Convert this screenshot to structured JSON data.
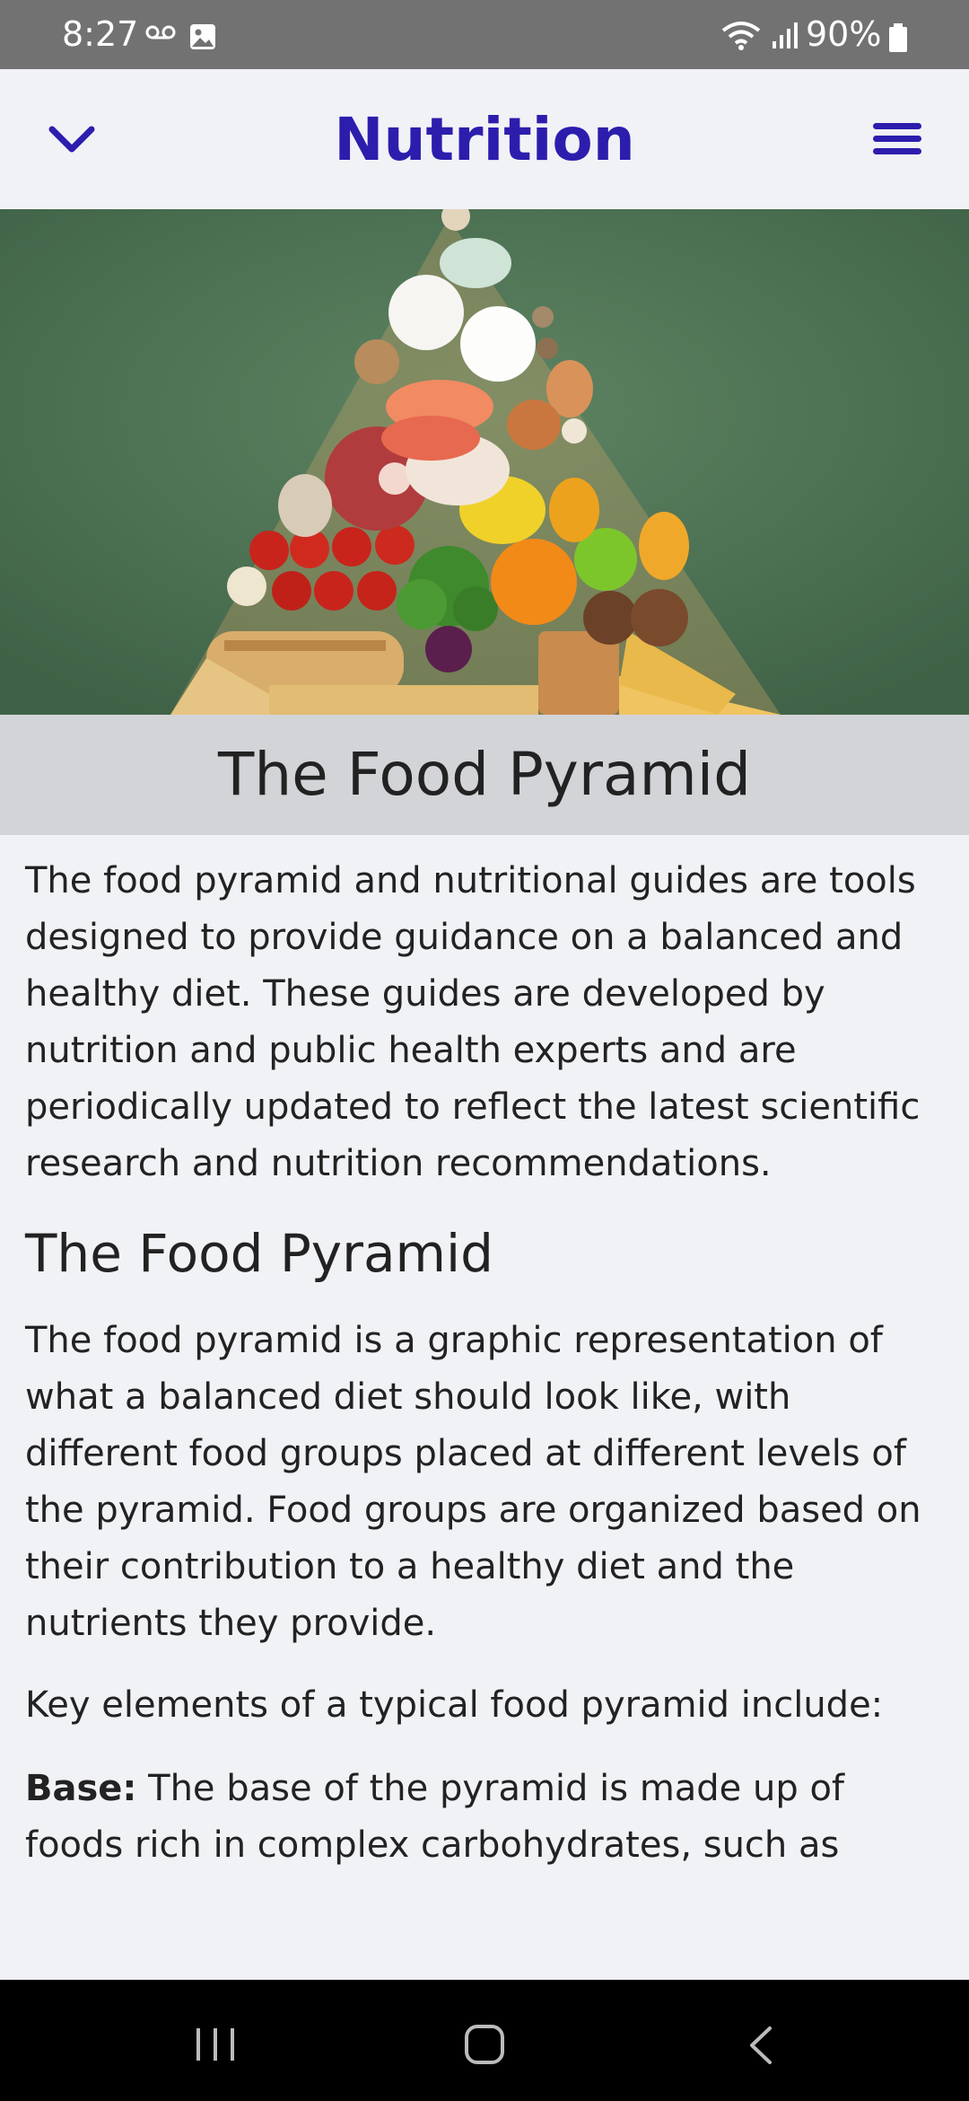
{
  "status_bar": {
    "time": "8:27",
    "battery": "90%"
  },
  "app_bar": {
    "title": "Nutrition",
    "collapse_icon": "chevron-down-icon",
    "menu_icon": "hamburger-menu-icon"
  },
  "hero_image": {
    "description_icon": "food-pyramid-photo"
  },
  "title_band": {
    "title": "The Food Pyramid"
  },
  "content": {
    "intro": "The food pyramid and nutritional guides are tools designed to provide guidance on a balanced and healthy diet. These guides are developed by nutrition and public health experts and are periodically updated to reflect the latest scientific research and nutrition recommendations.",
    "section_heading": "The Food Pyramid",
    "section_para": "The food pyramid is a graphic representation of what a balanced diet should look like, with different food groups placed at different levels of the pyramid. Food groups are organized based on their contribution to a healthy diet and the nutrients they provide.",
    "key_elements": "Key elements of a typical food pyramid include:",
    "base_label": "Base:",
    "base_text": " The base of the pyramid is made up of foods rich in complex carbohydrates, such as"
  },
  "colors": {
    "accent": "#2d1dad",
    "title_band_bg": "#d3d4d8",
    "page_bg": "#f1f2f6",
    "hero_bg": "#53775a"
  }
}
